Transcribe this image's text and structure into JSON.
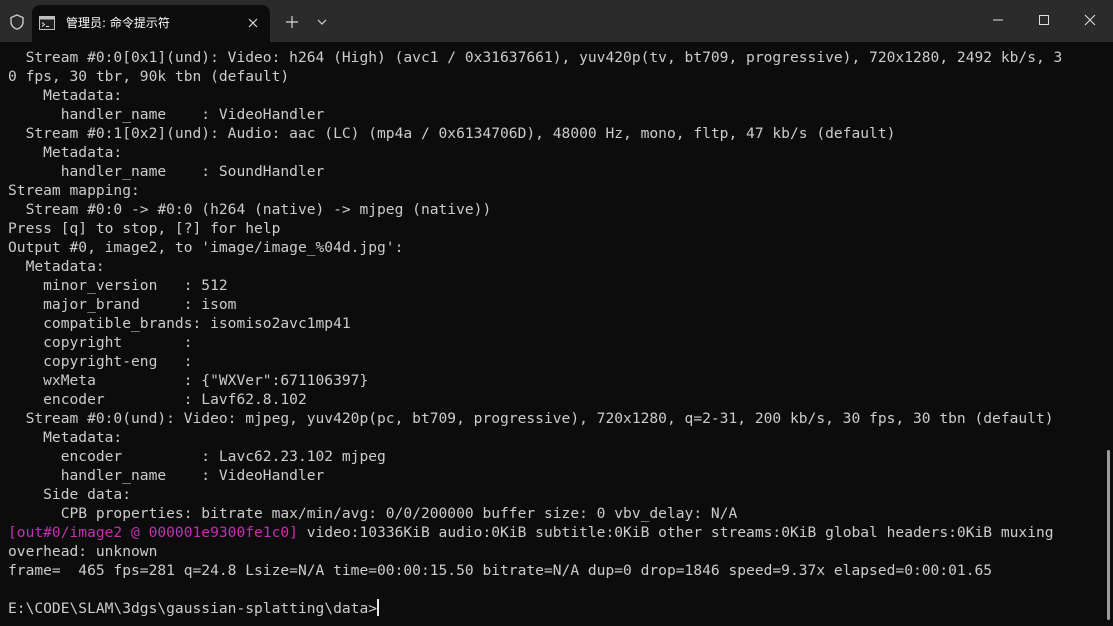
{
  "window": {
    "tab_title": "管理员: 命令提示符",
    "new_tab_symbol": "+",
    "icons": {
      "shield": "shield-icon",
      "tab": "command-prompt-icon",
      "close_tab": "close-icon",
      "new_tab": "plus-icon",
      "dropdown": "chevron-down-icon",
      "minimize": "minimize-icon",
      "maximize": "maximize-icon",
      "close_window": "close-icon"
    }
  },
  "colors": {
    "background": "#0c0c0c",
    "titlebar": "#2b2b2b",
    "text": "#cccccc",
    "magenta_tag": "#c62fb4"
  },
  "console": {
    "lines": [
      "  Stream #0:0[0x1](und): Video: h264 (High) (avc1 / 0x31637661), yuv420p(tv, bt709, progressive), 720x1280, 2492 kb/s, 3",
      "0 fps, 30 tbr, 90k tbn (default)",
      "    Metadata:",
      "      handler_name    : VideoHandler",
      "  Stream #0:1[0x2](und): Audio: aac (LC) (mp4a / 0x6134706D), 48000 Hz, mono, fltp, 47 kb/s (default)",
      "    Metadata:",
      "      handler_name    : SoundHandler",
      "Stream mapping:",
      "  Stream #0:0 -> #0:0 (h264 (native) -> mjpeg (native))",
      "Press [q] to stop, [?] for help",
      "Output #0, image2, to 'image/image_%04d.jpg':",
      "  Metadata:",
      "    minor_version   : 512",
      "    major_brand     : isom",
      "    compatible_brands: isomiso2avc1mp41",
      "    copyright       :",
      "    copyright-eng   :",
      "    wxMeta          : {\"WXVer\":671106397}",
      "    encoder         : Lavf62.8.102",
      "  Stream #0:0(und): Video: mjpeg, yuv420p(pc, bt709, progressive), 720x1280, q=2-31, 200 kb/s, 30 fps, 30 tbn (default)",
      "    Metadata:",
      "      encoder         : Lavc62.23.102 mjpeg",
      "      handler_name    : VideoHandler",
      "    Side data:",
      "      CPB properties: bitrate max/min/avg: 0/0/200000 buffer size: 0 vbv_delay: N/A"
    ],
    "out_tag": "[out#0/image2 @ 000001e9300fe1c0]",
    "out_rest": " video:10336KiB audio:0KiB subtitle:0KiB other streams:0KiB global headers:0KiB muxing",
    "out_line2": "overhead: unknown",
    "progress_line": "frame=  465 fps=281 q=24.8 Lsize=N/A time=00:00:15.50 bitrate=N/A dup=0 drop=1846 speed=9.37x elapsed=0:00:01.65",
    "blank_line": "",
    "prompt": "E:\\CODE\\SLAM\\3dgs\\gaussian-splatting\\data>"
  }
}
